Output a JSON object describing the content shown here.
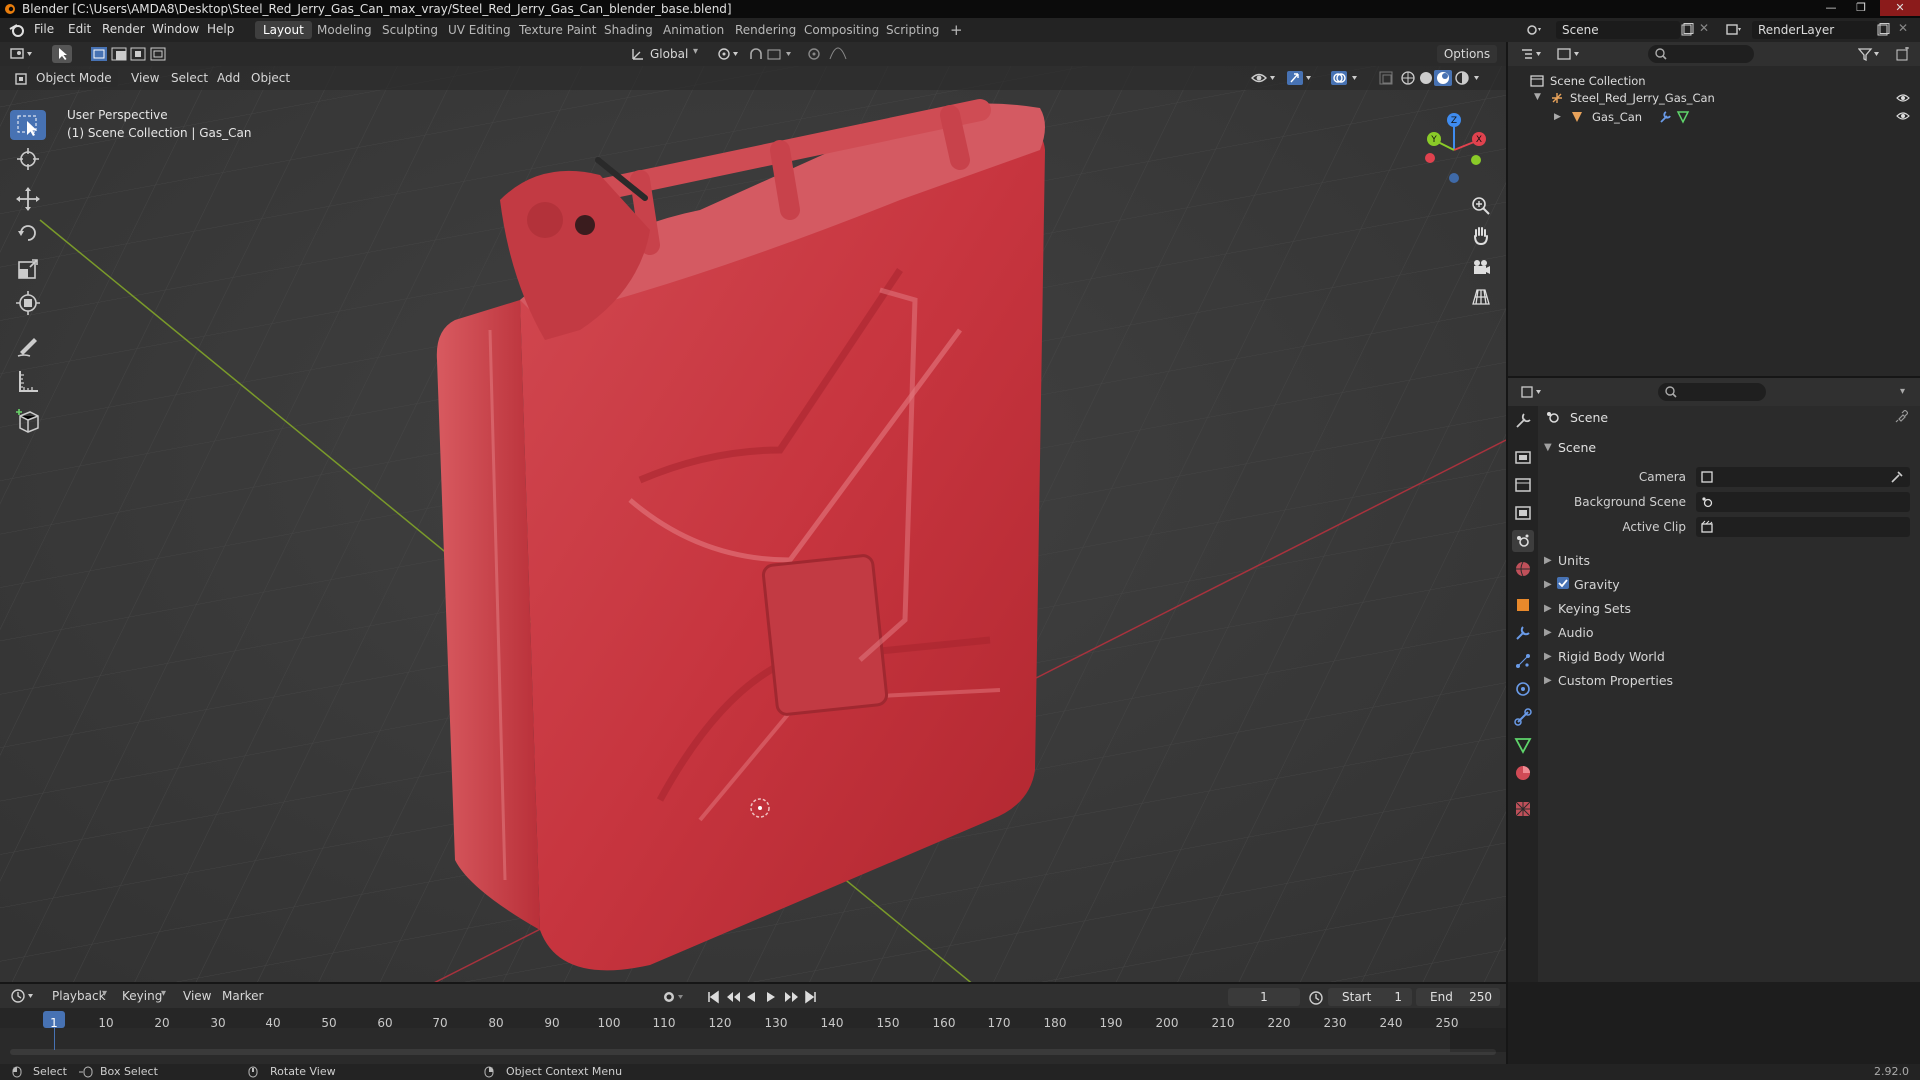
{
  "window": {
    "title": "Blender [C:\\Users\\AMDA8\\Desktop\\Steel_Red_Jerry_Gas_Can_max_vray/Steel_Red_Jerry_Gas_Can_blender_base.blend]"
  },
  "menubar": {
    "menus": [
      "File",
      "Edit",
      "Render",
      "Window",
      "Help"
    ],
    "workspaces": [
      "Layout",
      "Modeling",
      "Sculpting",
      "UV Editing",
      "Texture Paint",
      "Shading",
      "Animation",
      "Rendering",
      "Compositing",
      "Scripting"
    ],
    "active_workspace": "Layout",
    "add_tab": "+",
    "scene_name": "Scene",
    "view_layer": "RenderLayer"
  },
  "viewport_header": {
    "transform_orientation": "Global",
    "options_label": "Options",
    "mode": "Object Mode",
    "menus": [
      "View",
      "Select",
      "Add",
      "Object"
    ]
  },
  "viewport": {
    "perspective_label": "User Perspective",
    "collection_label": "(1) Scene Collection | Gas_Can",
    "gizmo_axes": {
      "x": "X",
      "y": "Y",
      "z": "Z"
    }
  },
  "outliner": {
    "root": "Scene Collection",
    "items": [
      {
        "name": "Steel_Red_Jerry_Gas_Can"
      },
      {
        "name": "Gas_Can"
      }
    ]
  },
  "properties": {
    "header": "Scene",
    "section": "Scene",
    "fields": [
      {
        "label": "Camera"
      },
      {
        "label": "Background Scene"
      },
      {
        "label": "Active Clip"
      }
    ],
    "panels": [
      "Units",
      "Gravity",
      "Keying Sets",
      "Audio",
      "Rigid Body World",
      "Custom Properties"
    ],
    "gravity_checked": true
  },
  "timeline": {
    "menus": [
      "Playback",
      "Keying",
      "View",
      "Marker"
    ],
    "current_frame": "1",
    "start_label": "Start",
    "start": "1",
    "end_label": "End",
    "end": "250",
    "ruler": [
      "10",
      "20",
      "30",
      "40",
      "50",
      "60",
      "70",
      "80",
      "90",
      "100",
      "110",
      "120",
      "130",
      "140",
      "150",
      "160",
      "170",
      "180",
      "190",
      "200",
      "210",
      "220",
      "230",
      "240",
      "250"
    ],
    "playhead": "1"
  },
  "statusbar": {
    "hints": [
      "Select",
      "Box Select",
      "Rotate View",
      "Object Context Menu"
    ],
    "version": "2.92.0"
  },
  "colors": {
    "accent": "#4772b3",
    "viewport_bg": "#3a3a3a",
    "gas_can": "#c8353f",
    "x_axis": "#e0424e",
    "y_axis": "#8acb28",
    "z_axis": "#3f8cf0"
  }
}
